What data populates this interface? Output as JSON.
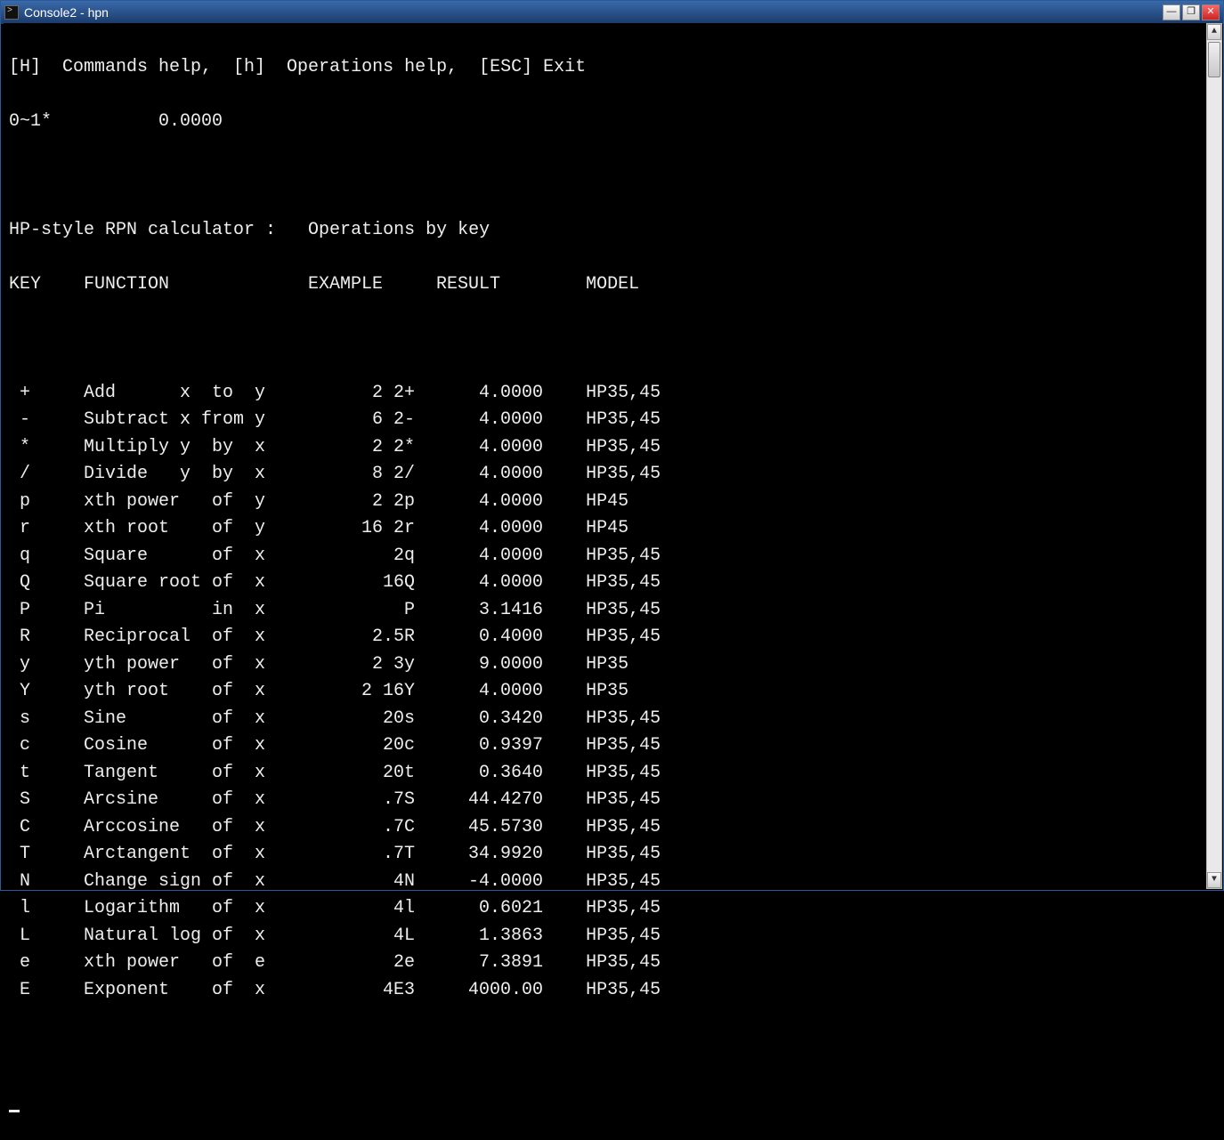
{
  "window_title": "Console2 - hpn",
  "help_line": "[H]  Commands help,  [h]  Operations help,  [ESC] Exit",
  "status_line": "0~1*          0.0000",
  "doc_title": "HP-style RPN calculator :   Operations by key",
  "headers": {
    "key": "KEY",
    "func": "FUNCTION",
    "example": "EXAMPLE",
    "result": "RESULT",
    "model": "MODEL"
  },
  "ops": [
    {
      "key": " +",
      "func": "Add      x  to  y",
      "ex": "2 2+",
      "res": "4.0000",
      "model": "HP35,45"
    },
    {
      "key": " -",
      "func": "Subtract x from y",
      "ex": "6 2-",
      "res": "4.0000",
      "model": "HP35,45"
    },
    {
      "key": " *",
      "func": "Multiply y  by  x",
      "ex": "2 2*",
      "res": "4.0000",
      "model": "HP35,45"
    },
    {
      "key": " /",
      "func": "Divide   y  by  x",
      "ex": "8 2/",
      "res": "4.0000",
      "model": "HP35,45"
    },
    {
      "key": " p",
      "func": "xth power   of  y",
      "ex": "2 2p",
      "res": "4.0000",
      "model": "HP45"
    },
    {
      "key": " r",
      "func": "xth root    of  y",
      "ex": "16 2r",
      "res": "4.0000",
      "model": "HP45"
    },
    {
      "key": " q",
      "func": "Square      of  x",
      "ex": "2q",
      "res": "4.0000",
      "model": "HP35,45"
    },
    {
      "key": " Q",
      "func": "Square root of  x",
      "ex": "16Q",
      "res": "4.0000",
      "model": "HP35,45"
    },
    {
      "key": " P",
      "func": "Pi          in  x",
      "ex": "P",
      "res": "3.1416",
      "model": "HP35,45"
    },
    {
      "key": " R",
      "func": "Reciprocal  of  x",
      "ex": "2.5R",
      "res": "0.4000",
      "model": "HP35,45"
    },
    {
      "key": " y",
      "func": "yth power   of  x",
      "ex": "2 3y",
      "res": "9.0000",
      "model": "HP35"
    },
    {
      "key": " Y",
      "func": "yth root    of  x",
      "ex": "2 16Y",
      "res": "4.0000",
      "model": "HP35"
    },
    {
      "key": " s",
      "func": "Sine        of  x",
      "ex": "20s",
      "res": "0.3420",
      "model": "HP35,45"
    },
    {
      "key": " c",
      "func": "Cosine      of  x",
      "ex": "20c",
      "res": "0.9397",
      "model": "HP35,45"
    },
    {
      "key": " t",
      "func": "Tangent     of  x",
      "ex": "20t",
      "res": "0.3640",
      "model": "HP35,45"
    },
    {
      "key": " S",
      "func": "Arcsine     of  x",
      "ex": ".7S",
      "res": "44.4270",
      "model": "HP35,45"
    },
    {
      "key": " C",
      "func": "Arccosine   of  x",
      "ex": ".7C",
      "res": "45.5730",
      "model": "HP35,45"
    },
    {
      "key": " T",
      "func": "Arctangent  of  x",
      "ex": ".7T",
      "res": "34.9920",
      "model": "HP35,45"
    },
    {
      "key": " N",
      "func": "Change sign of  x",
      "ex": "4N",
      "res": "-4.0000",
      "model": "HP35,45"
    },
    {
      "key": " l",
      "func": "Logarithm   of  x",
      "ex": "4l",
      "res": "0.6021",
      "model": "HP35,45"
    },
    {
      "key": " L",
      "func": "Natural log of  x",
      "ex": "4L",
      "res": "1.3863",
      "model": "HP35,45"
    },
    {
      "key": " e",
      "func": "xth power   of  e",
      "ex": "2e",
      "res": "7.3891",
      "model": "HP35,45"
    },
    {
      "key": " E",
      "func": "Exponent    of  x",
      "ex": "4E3",
      "res": "4000.00",
      "model": "HP35,45"
    }
  ]
}
